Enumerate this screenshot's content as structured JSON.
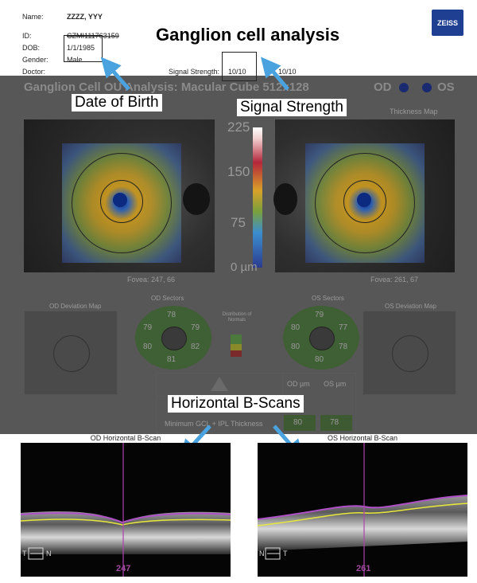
{
  "header": {
    "name_label": "Name:",
    "name_value": "ZZZZ, YYY",
    "id_label": "ID:",
    "id_value": "CZMI111763159",
    "dob_label": "DOB:",
    "dob_value": "1/1/1985",
    "gender_label": "Gender:",
    "gender_value": "Male",
    "doctor_label": "Doctor:",
    "signal_label": "Signal Strength:",
    "signal_od": "10/10",
    "signal_os": "10/10",
    "title": "Ganglion cell analysis",
    "logo_text": "ZEISS"
  },
  "report": {
    "subtitle": "Ganglion Cell OU Analysis: Macular Cube 512x128",
    "od_label": "OD",
    "os_label": "OS",
    "thickness_map_label": "Thickness Map",
    "colorbar_ticks": [
      "225",
      "150",
      "75",
      "0 µm"
    ],
    "fovea_od": "Fovea: 247, 66",
    "fovea_os": "Fovea: 261, 67",
    "od_deviation_label": "OD Deviation Map",
    "os_deviation_label": "OS Deviation Map",
    "od_sectors_label": "OD Sectors",
    "os_sectors_label": "OS Sectors",
    "od_sector_values": [
      "78",
      "79",
      "79",
      "80",
      "82",
      "81"
    ],
    "os_sector_values": [
      "79",
      "80",
      "77",
      "80",
      "78",
      "80"
    ],
    "legend_title": "Distribution of Normals",
    "table_col_od": "OD µm",
    "table_col_os": "OS µm",
    "table_row_label": "Minimum GCL + IPL Thickness",
    "table_od_value": "80",
    "table_os_value": "78"
  },
  "annotations": {
    "dob": "Date of Birth",
    "signal": "Signal Strength",
    "bscans": "Horizontal B-Scans"
  },
  "bscans": {
    "od_caption": "OD Horizontal B-Scan",
    "os_caption": "OS Horizontal B-Scan",
    "od_position": "247",
    "os_position": "261",
    "od_left": "T",
    "od_right": "N",
    "os_left": "N",
    "os_right": "T"
  },
  "colors": {
    "annotation_arrow": "#4aa3df",
    "scan_line": "#b040b0",
    "layer_purple": "#b050c8",
    "layer_yellow": "#e8e83a",
    "zeiss_blue": "#1f3f93"
  }
}
